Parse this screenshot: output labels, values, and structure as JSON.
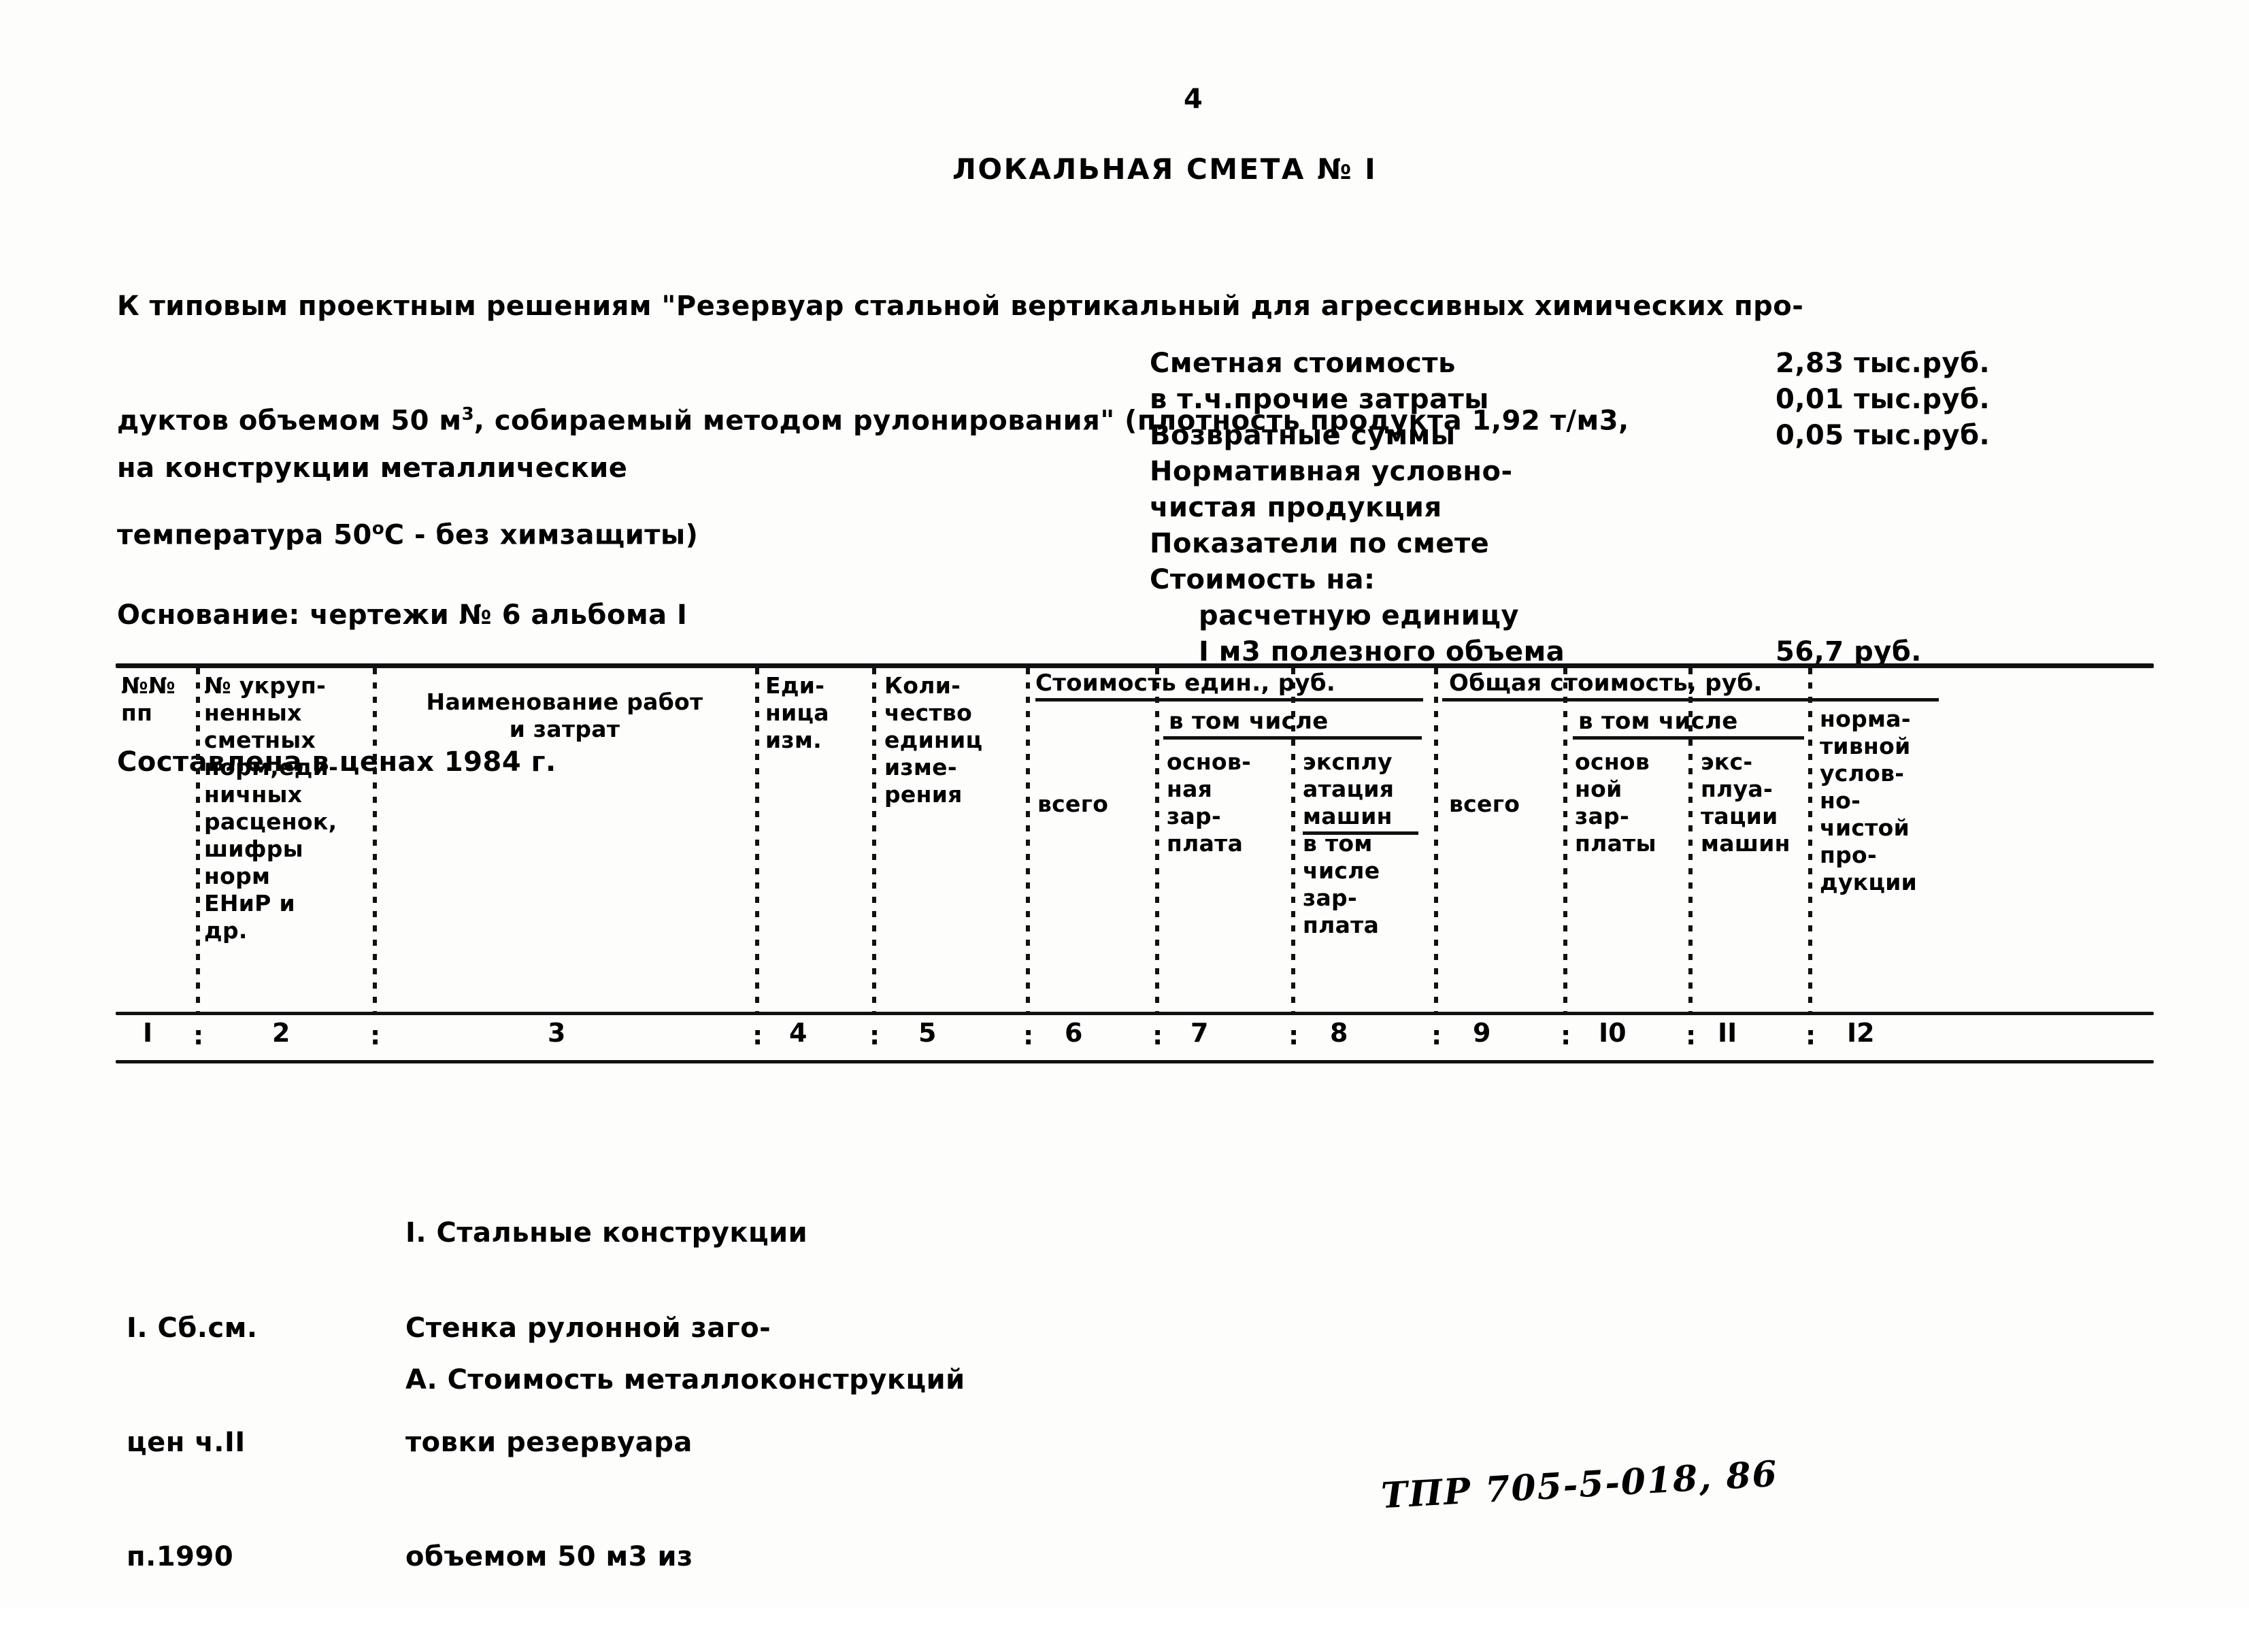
{
  "page_number": "4",
  "doc_title": "ЛОКАЛЬНАЯ СМЕТА № I",
  "intro": {
    "line1": "К типовым проектным решениям \"Резервуар стальной вертикальный для агрессивных химических про-",
    "line2_a": "дуктов объемом 50 м",
    "line2_sup": "3",
    "line2_b": ", собираемый методом рулонирования\" (плотность продукта 1,92 т/м3,",
    "line3_a": "температура 50",
    "line3_sup": "о",
    "line3_b": "С - без химзащиты)"
  },
  "left_block": {
    "line1": "на конструкции металлические",
    "line2": "Основание: чертежи № 6 альбома I",
    "line3": "Составлена в ценах 1984 г."
  },
  "right_block": {
    "rows": [
      {
        "label": "Сметная стоимость",
        "value": "2,83 тыс.руб.",
        "indent": false
      },
      {
        "label": "в т.ч.прочие затраты",
        "value": "0,01 тыс.руб.",
        "indent": false
      },
      {
        "label": "Возвратные суммы",
        "value": "0,05 тыс.руб.",
        "indent": false
      },
      {
        "label": "Нормативная условно-",
        "value": "",
        "indent": false
      },
      {
        "label": "чистая продукция",
        "value": "",
        "indent": false
      },
      {
        "label": "Показатели по смете",
        "value": "",
        "indent": false
      },
      {
        "label": "Стоимость на:",
        "value": "",
        "indent": false
      },
      {
        "label": "расчетную единицу",
        "value": "",
        "indent": true
      },
      {
        "label": "I м3 полезного объема",
        "value": "56,7 руб.",
        "indent": true
      }
    ]
  },
  "table": {
    "columns": [
      {
        "num": "I",
        "header": "№№\nпп"
      },
      {
        "num": "2",
        "header": "№ укруп-\nненных\nсметных\nнорм,еди-\nничных\nрасценок,\nшифры\nнорм\nЕНиР и\nдр."
      },
      {
        "num": "3",
        "header": "Наименование работ\nи затрат"
      },
      {
        "num": "4",
        "header": "Еди-\nница\nизм."
      },
      {
        "num": "5",
        "header": "Коли-\nчество\nединиц\nизме-\nрения"
      },
      {
        "num": "6",
        "header": "всего"
      },
      {
        "num": "7",
        "header": "основ-\nная\nзар-\nплата"
      },
      {
        "num": "8",
        "header": "эксплу\nатация\nмашин\nв том\nчисле\nзар-\nплата"
      },
      {
        "num": "9",
        "header": "всего"
      },
      {
        "num": "I0",
        "header": "основ\nной\nзар-\nплаты"
      },
      {
        "num": "II",
        "header": "экс-\nплуа-\nтации\nмашин"
      },
      {
        "num": "I2",
        "header": "норма-\nтивной\nуслов-\nно-\nчистой\nпро-\nдукции"
      }
    ],
    "group_headers": [
      {
        "label": "Стоимость един., руб.",
        "spans": "6-8"
      },
      {
        "label": "Общая стоимость, руб.",
        "spans": "9-12"
      },
      {
        "label": "в том числе",
        "spans": "7-8"
      },
      {
        "label": "в том числе",
        "spans": "10-11"
      },
      {
        "label": "машин",
        "note": "underline under 'машин' in col 8"
      }
    ]
  },
  "body": {
    "section_1": "I. Стальные конструкции",
    "section_a": "А. Стоимость металлоконструкций",
    "row1": {
      "code_line1": "I. Сб.см.",
      "code_line2": "цен ч.II",
      "code_line3": "п.1990",
      "desc_line1": "Стенка рулонной заго-",
      "desc_line2": "товки резервуара",
      "desc_line3": "объемом 50 м3 из"
    }
  },
  "stamp": "ТПР 705-5-018, 86"
}
